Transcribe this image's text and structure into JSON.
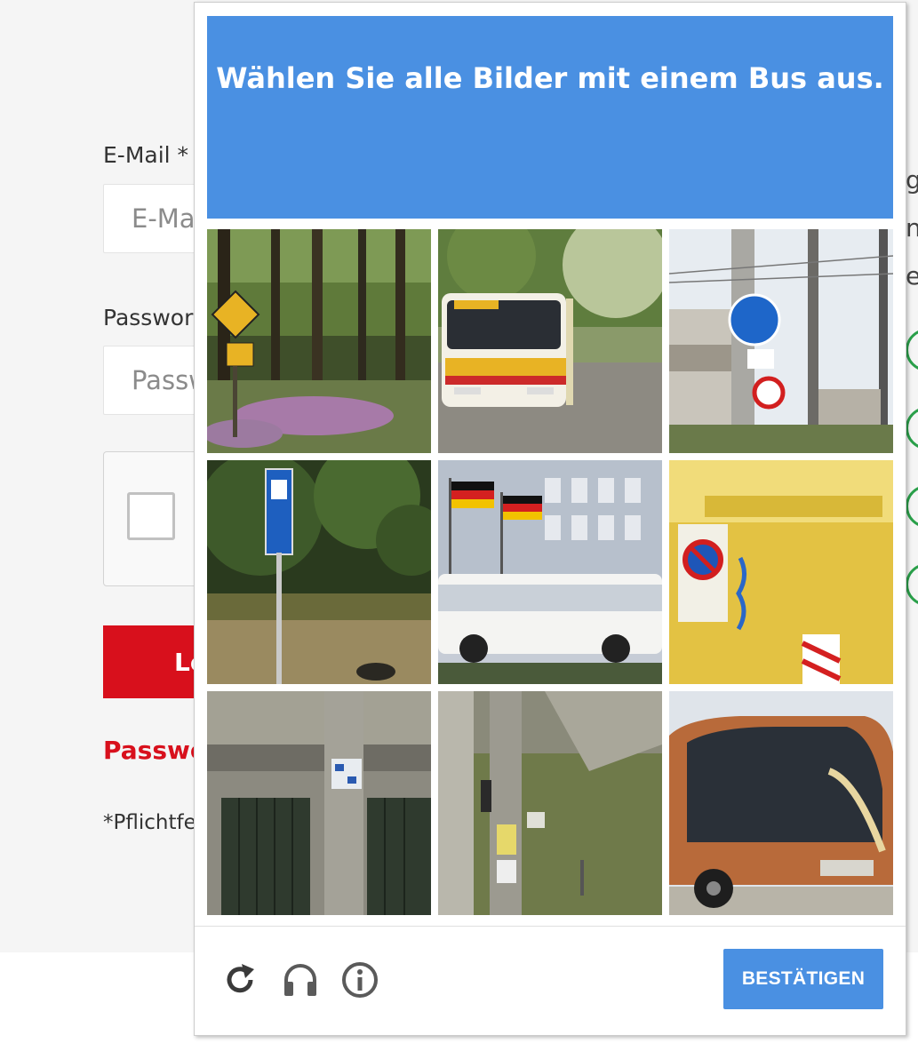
{
  "login": {
    "email_label": "E-Mail *",
    "email_placeholder": "E-Mail",
    "password_label": "Passwort *",
    "password_placeholder": "Passwort",
    "login_button": "Login",
    "forgot_link": "Passwort vergessen?",
    "required_note": "*Pflichtfelder",
    "side_fragments": [
      "g",
      "n",
      "e"
    ],
    "check_icons": [
      "check-circle-icon",
      "check-circle-icon",
      "check-circle-icon",
      "check-circle-icon"
    ]
  },
  "captcha": {
    "instruction_prefix": "Wählen Sie alle Bilder mit einem ",
    "instruction_keyword": "Bus",
    "instruction_suffix": " aus.",
    "tiles": [
      {
        "subject": "forest road with deer crossing sign"
      },
      {
        "subject": "white and yellow coach bus"
      },
      {
        "subject": "street with traffic signs and poles"
      },
      {
        "subject": "bus stop sign near trees"
      },
      {
        "subject": "white bus in front of building with flags"
      },
      {
        "subject": "yellow container with no parking sign"
      },
      {
        "subject": "concrete pole in front of building"
      },
      {
        "subject": "utility pole and grass"
      },
      {
        "subject": "orange coach bus"
      }
    ],
    "footer": {
      "reload_icon": "reload-icon",
      "audio_icon": "headphones-icon",
      "info_icon": "info-icon",
      "verify_button": "BESTÄTIGEN"
    },
    "colors": {
      "accent": "#4a90e2",
      "brand_red": "#d8101c",
      "success": "#2aa04a"
    }
  }
}
